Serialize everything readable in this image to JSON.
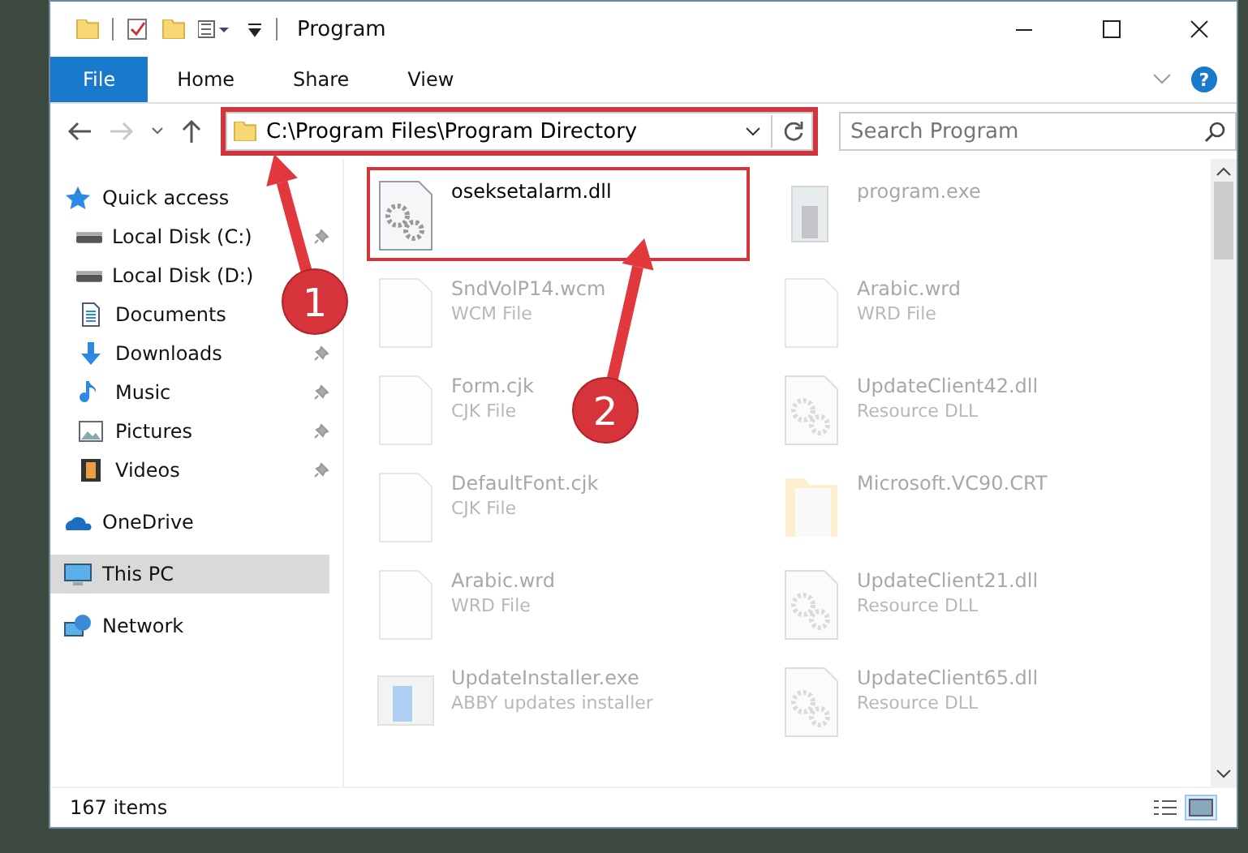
{
  "window": {
    "title": "Program"
  },
  "ribbon": {
    "tabs": [
      {
        "label": "File",
        "selected": true
      },
      {
        "label": "Home",
        "selected": false
      },
      {
        "label": "Share",
        "selected": false
      },
      {
        "label": "View",
        "selected": false
      }
    ],
    "help": "?"
  },
  "nav": {
    "back_disabled": false,
    "forward_disabled": true,
    "address": {
      "value": "C:\\Program Files\\Program Directory",
      "annotated": true
    },
    "search": {
      "placeholder": "Search Program"
    }
  },
  "sidebar": {
    "items": [
      {
        "label": "Quick access",
        "kind": "star",
        "selected": false,
        "children": [
          {
            "label": "Local Disk (C:)",
            "kind": "drive",
            "pinned": true,
            "selected": false
          },
          {
            "label": "Local Disk (D:)",
            "kind": "drive",
            "pinned": false,
            "selected": false
          },
          {
            "label": "Documents",
            "kind": "documents",
            "pinned": false,
            "selected": false
          },
          {
            "label": "Downloads",
            "kind": "download",
            "pinned": true,
            "selected": false
          },
          {
            "label": "Music",
            "kind": "music",
            "pinned": true,
            "selected": false
          },
          {
            "label": "Pictures",
            "kind": "pictures",
            "pinned": true,
            "selected": false
          },
          {
            "label": "Videos",
            "kind": "videos",
            "pinned": true,
            "selected": false
          }
        ]
      },
      {
        "label": "OneDrive",
        "kind": "cloud",
        "selected": false
      },
      {
        "label": "This PC",
        "kind": "computer",
        "selected": true
      },
      {
        "label": "Network",
        "kind": "network",
        "selected": false
      }
    ]
  },
  "files": [
    {
      "name": "oseksetalarm.dll",
      "kind": "gears",
      "faded": false,
      "annotated": true
    },
    {
      "name": "program.exe",
      "kind": "exe",
      "faded": true,
      "annotated": false
    },
    {
      "name": "SndVolP14.wcm",
      "type": "WCM File",
      "kind": "blank",
      "faded": true,
      "annotated": false
    },
    {
      "name": "Arabic.wrd",
      "type": "WRD File",
      "kind": "blank",
      "faded": true,
      "annotated": false
    },
    {
      "name": "Form.cjk",
      "type": "CJK File",
      "kind": "blank",
      "faded": true,
      "annotated": false
    },
    {
      "name": "UpdateClient42.dll",
      "type": "Resource DLL",
      "kind": "gears",
      "faded": true,
      "annotated": false
    },
    {
      "name": "DefaultFont.cjk",
      "type": "CJK File",
      "kind": "blank",
      "faded": true,
      "annotated": false
    },
    {
      "name": "Microsoft.VC90.CRT",
      "kind": "folder",
      "faded": true,
      "annotated": false
    },
    {
      "name": "Arabic.wrd",
      "type": "WRD File",
      "kind": "blank",
      "faded": true,
      "annotated": false
    },
    {
      "name": "UpdateClient21.dll",
      "type": "Resource DLL",
      "kind": "gears",
      "faded": true,
      "annotated": false
    },
    {
      "name": "UpdateInstaller.exe",
      "type": "ABBY updates installer",
      "kind": "installer",
      "faded": true,
      "annotated": false
    },
    {
      "name": "UpdateClient65.dll",
      "type": "Resource DLL",
      "kind": "gears",
      "faded": true,
      "annotated": false
    }
  ],
  "status_bar": {
    "count": "167 items",
    "views": [
      {
        "kind": "details",
        "selected": false
      },
      {
        "kind": "large",
        "selected": true
      }
    ]
  },
  "callouts": [
    {
      "number": "1"
    },
    {
      "number": "2"
    }
  ]
}
